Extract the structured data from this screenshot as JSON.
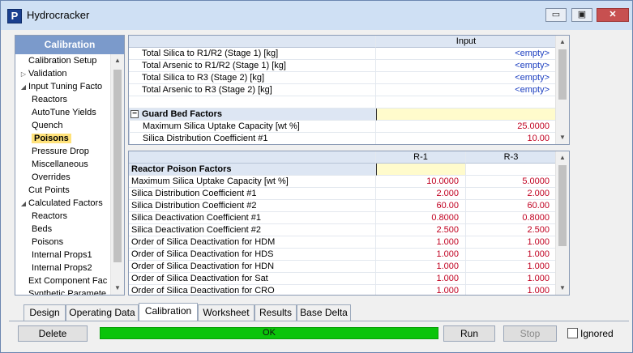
{
  "window": {
    "title": "Hydrocracker",
    "app_icon": "P",
    "buttons": {
      "minimize": "▭",
      "restore": "▣",
      "close": "✕"
    }
  },
  "sidebar": {
    "header": "Calibration",
    "items": [
      {
        "label": "Calibration Setup",
        "indent": 0,
        "arrow": ""
      },
      {
        "label": "Validation",
        "indent": 0,
        "arrow": "▷"
      },
      {
        "label": "Input Tuning Facto",
        "indent": 0,
        "arrow": "◢"
      },
      {
        "label": "Reactors",
        "indent": 1,
        "arrow": ""
      },
      {
        "label": "AutoTune Yields",
        "indent": 1,
        "arrow": ""
      },
      {
        "label": "Quench",
        "indent": 1,
        "arrow": ""
      },
      {
        "label": "Poisons",
        "indent": 1,
        "arrow": "",
        "selected": true
      },
      {
        "label": "Pressure Drop",
        "indent": 1,
        "arrow": ""
      },
      {
        "label": "Miscellaneous",
        "indent": 1,
        "arrow": ""
      },
      {
        "label": "Overrides",
        "indent": 1,
        "arrow": ""
      },
      {
        "label": "Cut Points",
        "indent": 0,
        "arrow": ""
      },
      {
        "label": "Calculated Factors",
        "indent": 0,
        "arrow": "◢"
      },
      {
        "label": "Reactors",
        "indent": 1,
        "arrow": ""
      },
      {
        "label": "Beds",
        "indent": 1,
        "arrow": ""
      },
      {
        "label": "Poisons",
        "indent": 1,
        "arrow": ""
      },
      {
        "label": "Internal Props1",
        "indent": 1,
        "arrow": ""
      },
      {
        "label": "Internal Props2",
        "indent": 1,
        "arrow": ""
      },
      {
        "label": "Ext Component Fac",
        "indent": 0,
        "arrow": ""
      },
      {
        "label": "Synthetic Paramete",
        "indent": 0,
        "arrow": ""
      }
    ]
  },
  "top_grid": {
    "column_header": "Input",
    "rows": [
      {
        "label": "Total Silica to R1/R2 (Stage 1) [kg]",
        "value": "<empty>",
        "kind": "empty"
      },
      {
        "label": "Total Arsenic to R1/R2 (Stage 1) [kg]",
        "value": "<empty>",
        "kind": "empty"
      },
      {
        "label": "Total Silica to R3 (Stage 2) [kg]",
        "value": "<empty>",
        "kind": "empty"
      },
      {
        "label": "Total Arsenic to R3 (Stage 2) [kg]",
        "value": "<empty>",
        "kind": "empty"
      },
      {
        "label": "",
        "value": "",
        "kind": "blank"
      },
      {
        "label": "Guard Bed Factors",
        "value": "",
        "kind": "section"
      },
      {
        "label": "Maximum Silica Uptake Capacity [wt %]",
        "value": "25.0000",
        "kind": "value"
      },
      {
        "label": "Silica Distribution Coefficient #1",
        "value": "10.00",
        "kind": "value"
      }
    ],
    "collapse_glyph": "−"
  },
  "bottom_grid": {
    "column_headers": [
      "R-1",
      "R-3"
    ],
    "section_label": "Reactor Poison Factors",
    "rows": [
      {
        "label": "Maximum Silica Uptake Capacity [wt %]",
        "r1": "10.0000",
        "r3": "5.0000"
      },
      {
        "label": "Silica Distribution Coefficient #1",
        "r1": "2.000",
        "r3": "2.000"
      },
      {
        "label": "Silica Distribution Coefficient #2",
        "r1": "60.00",
        "r3": "60.00"
      },
      {
        "label": "Silica Deactivation Coefficient #1",
        "r1": "0.8000",
        "r3": "0.8000"
      },
      {
        "label": "Silica Deactivation Coefficient #2",
        "r1": "2.500",
        "r3": "2.500"
      },
      {
        "label": "Order of Silica Deactivation for HDM",
        "r1": "1.000",
        "r3": "1.000"
      },
      {
        "label": "Order of Silica Deactivation for HDS",
        "r1": "1.000",
        "r3": "1.000"
      },
      {
        "label": "Order of Silica Deactivation for HDN",
        "r1": "1.000",
        "r3": "1.000"
      },
      {
        "label": "Order of Silica Deactivation for Sat",
        "r1": "1.000",
        "r3": "1.000"
      },
      {
        "label": "Order of Silica Deactivation for CRO",
        "r1": "1.000",
        "r3": "1.000"
      }
    ]
  },
  "tabs": [
    "Design",
    "Operating Data",
    "Calibration",
    "Worksheet",
    "Results",
    "Base Delta"
  ],
  "active_tab": "Calibration",
  "footer": {
    "delete_label": "Delete",
    "status_text": "OK",
    "run_label": "Run",
    "stop_label": "Stop",
    "ignored_label": "Ignored",
    "ignored_checked": false
  },
  "colors": {
    "value_red": "#c00020",
    "empty_blue": "#1c3fc0",
    "status_green": "#0ac40a",
    "selected_item": "#ffe27a",
    "panel_header": "#7b9acb"
  }
}
